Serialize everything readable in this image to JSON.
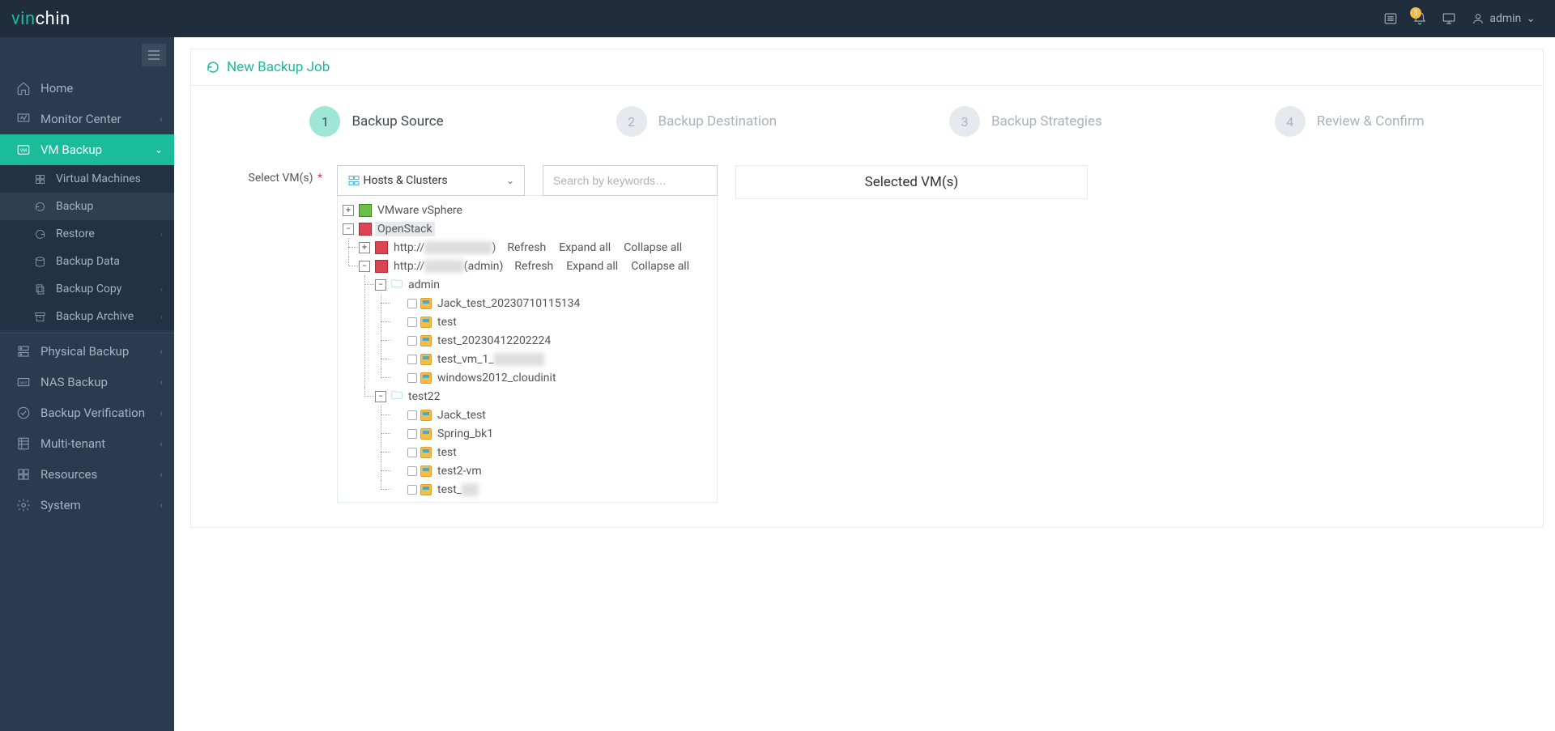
{
  "brand": {
    "part1": "vin",
    "part2": "chin"
  },
  "topbar": {
    "badge": "1",
    "user": "admin"
  },
  "sidebar": {
    "items": [
      {
        "label": "Home"
      },
      {
        "label": "Monitor Center"
      },
      {
        "label": "VM Backup"
      },
      {
        "label": "Physical Backup"
      },
      {
        "label": "NAS Backup"
      },
      {
        "label": "Backup Verification"
      },
      {
        "label": "Multi-tenant"
      },
      {
        "label": "Resources"
      },
      {
        "label": "System"
      }
    ],
    "vm_sub": [
      {
        "label": "Virtual Machines"
      },
      {
        "label": "Backup"
      },
      {
        "label": "Restore"
      },
      {
        "label": "Backup Data"
      },
      {
        "label": "Backup Copy"
      },
      {
        "label": "Backup Archive"
      }
    ]
  },
  "page": {
    "title": "New Backup Job",
    "steps": [
      {
        "n": "1",
        "label": "Backup Source"
      },
      {
        "n": "2",
        "label": "Backup Destination"
      },
      {
        "n": "3",
        "label": "Backup Strategies"
      },
      {
        "n": "4",
        "label": "Review & Confirm"
      }
    ],
    "form_label": "Select VM(s)",
    "dropdown": {
      "value": "Hosts & Clusters"
    },
    "search": {
      "placeholder": "Search by keywords…"
    },
    "selected_title": "Selected VM(s)",
    "actions": {
      "refresh": "Refresh",
      "expand": "Expand all",
      "collapse": "Collapse all"
    },
    "tree": {
      "vmware": "VMware vSphere",
      "openstack": "OpenStack",
      "host1_prefix": "http://",
      "host1_suffix_hidden": "xxxxxxxxxxxx",
      "host1_tail": ")",
      "host2_prefix": "http://",
      "host2_hidden": "xxxxxxx",
      "host2_tail": "(admin)",
      "folder1": "admin",
      "folder1_vms": [
        "Jack_test_20230710115134",
        "test",
        "test_20230412202224",
        "test_vm_1_",
        "windows2012_cloudinit"
      ],
      "folder1_vm3_hidden": "xxxxxxxxx",
      "folder2": "test22",
      "folder2_vms": [
        "Jack_test",
        "Spring_bk1",
        "test",
        "test2-vm",
        "test_"
      ],
      "folder2_vm4_hidden": "xxx"
    }
  }
}
